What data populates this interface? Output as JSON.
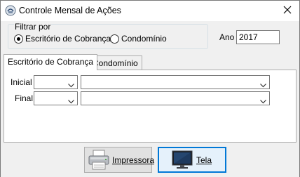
{
  "window": {
    "title": "Controle Mensal de Ações",
    "close_glyph": "✕"
  },
  "filter": {
    "legend": "Filtrar por",
    "options": [
      {
        "label": "Escritório de Cobrança",
        "checked": true
      },
      {
        "label": "Condomínio",
        "checked": false
      }
    ]
  },
  "ano": {
    "label": "Ano",
    "value": "2017"
  },
  "tabs": [
    {
      "label": "Escritório de Cobrança",
      "active": true
    },
    {
      "label": "Condomínio",
      "active": false
    }
  ],
  "panel": {
    "rows": [
      {
        "label": "Inicial",
        "code_value": "",
        "name_value": ""
      },
      {
        "label": "Final",
        "code_value": "",
        "name_value": ""
      }
    ]
  },
  "buttons": {
    "print_label": "Impressora",
    "screen_label": "Tela"
  },
  "icons": {
    "app": "app-icon",
    "close": "close-icon",
    "dropdown": "chevron-down-icon",
    "printer": "printer-icon",
    "monitor": "monitor-icon"
  },
  "colors": {
    "focus_border": "#0078d7",
    "focus_fill": "#e5f1fb",
    "button_fill": "#e1e1e1"
  }
}
